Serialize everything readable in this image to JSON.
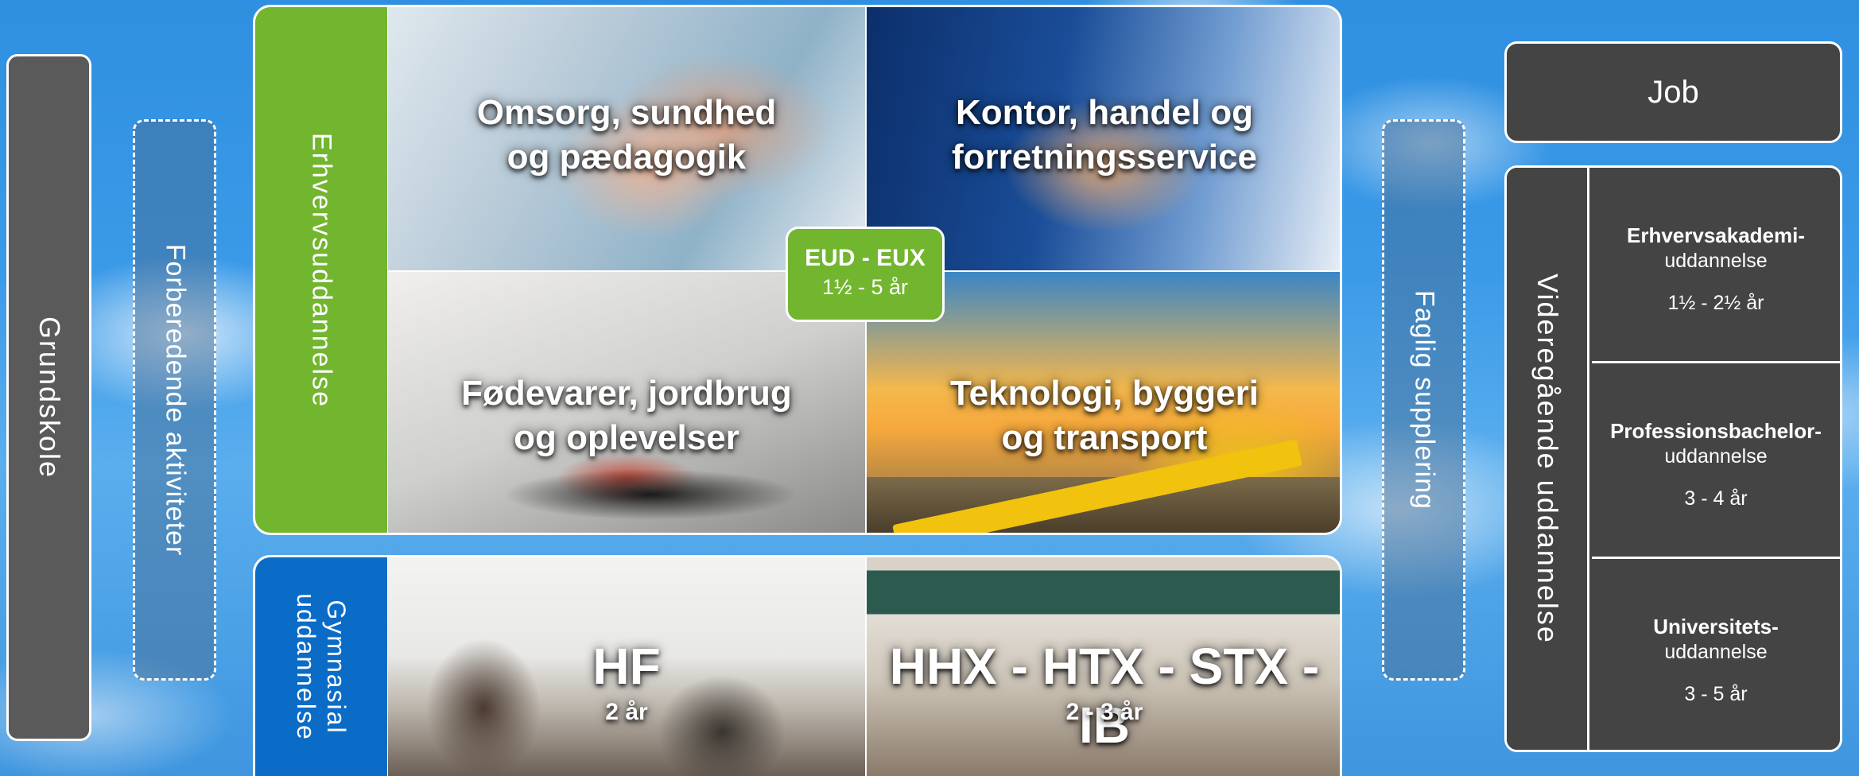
{
  "left": {
    "grundskole": "Grundskole",
    "forberedende": "Forberedende aktiviteter"
  },
  "erhverv": {
    "band_label": "Erhvervsuddannelse",
    "tiles": [
      {
        "line1": "Omsorg, sundhed",
        "line2": "og pædagogik"
      },
      {
        "line1": "Kontor, handel og",
        "line2": "forretningsservice"
      },
      {
        "line1": "Fødevarer, jordbrug",
        "line2": "og oplevelser"
      },
      {
        "line1": "Teknologi, byggeri",
        "line2": "og transport"
      }
    ],
    "badge": {
      "title": "EUD - EUX",
      "duration": "1½ - 5 år"
    },
    "band_color": "#72b52f"
  },
  "gymnasial": {
    "band_line1": "Gymnasial",
    "band_line2": "uddannelse",
    "band_color": "#0b6cc8",
    "hf": {
      "name": "HF",
      "duration": "2 år"
    },
    "other": {
      "name": "HHX - HTX - STX - IB",
      "duration": "2 - 3 år"
    }
  },
  "faglig": "Faglig supplering",
  "right": {
    "job": "Job",
    "videregaaende": "Videregående uddannelse",
    "rows": [
      {
        "name": "Erhvervsakademi-",
        "sub": "uddannelse",
        "duration": "1½ - 2½ år"
      },
      {
        "name": "Professionsbachelor-",
        "sub": "uddannelse",
        "duration": "3 - 4 år"
      },
      {
        "name": "Universitets-",
        "sub": "uddannelse",
        "duration": "3 - 5 år"
      }
    ]
  }
}
